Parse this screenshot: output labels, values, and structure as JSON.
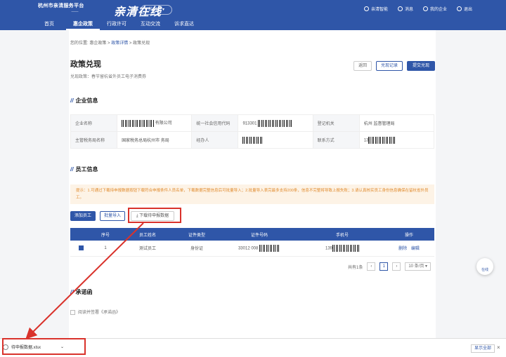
{
  "header": {
    "logo_line1": "杭州市亲清服务平台",
    "logo_line2": "亲清在线",
    "slogan": "亲清在线",
    "city": "杭州市",
    "top_links": [
      "亲清智能",
      "消息",
      "我的企业",
      "退出"
    ]
  },
  "nav": [
    "首页",
    "惠企政策",
    "行政许可",
    "互动交流",
    "诉求直达"
  ],
  "breadcrumb": {
    "prefix": "您的位置:",
    "items": [
      "惠企政策",
      "政策详情",
      "政策兑现"
    ],
    "sep": ">"
  },
  "page": {
    "title": "政策兑现",
    "subtitle": "兑现政策：春节留杭省外员工电子消费券",
    "buttons": {
      "back": "返回",
      "records": "兑现记录",
      "submit": "提交兑现"
    }
  },
  "company": {
    "section_title": "企业信息",
    "rows": [
      [
        {
          "label": "企业名称",
          "value": "有限公司"
        },
        {
          "label": "统一社会信用代码",
          "value": "913301"
        },
        {
          "label": "登记机关",
          "value": "杭州 监督管理局"
        }
      ],
      [
        {
          "label": "主管税务局名称",
          "value": "国家税务总局杭州市 务局"
        },
        {
          "label": "经办人",
          "value": ""
        },
        {
          "label": "联系方式",
          "value": "13"
        }
      ]
    ]
  },
  "employees": {
    "section_title": "员工信息",
    "notice": "提示：1.可通过下载待申报数据按钮下载符合申报条件人员名单，下载数据完整信息后可批量导入；2.批量导入表完最多支持200条，信息不完整将导致上报失败；3.请认真核实员工身份信息确保在留杭省外员工。",
    "buttons": {
      "add": "添加员工",
      "import": "批量导入",
      "download": "下载待申报数据"
    },
    "columns": [
      "",
      "序号",
      "员工姓名",
      "证件类型",
      "证件号码",
      "手机号",
      "操作"
    ],
    "rows": [
      {
        "index": "1",
        "name": "测试员工",
        "id_type": "身份证",
        "id_no": "33012 008",
        "phone": "139",
        "actions": [
          "删除",
          "编辑"
        ]
      }
    ],
    "pager": {
      "total": "共有1条",
      "page": "1",
      "size": "10 条/页"
    }
  },
  "promise": {
    "section_title": "承诺函",
    "text": "阅读并签署《承诺函》"
  },
  "float_button": "在线",
  "download_bar": {
    "file": "待申报数据.xlsx",
    "show_all": "显示全部",
    "close": "×"
  },
  "colors": {
    "primary": "#2f56a8",
    "highlight": "#d9322b",
    "notice_text": "#e08a2c"
  }
}
